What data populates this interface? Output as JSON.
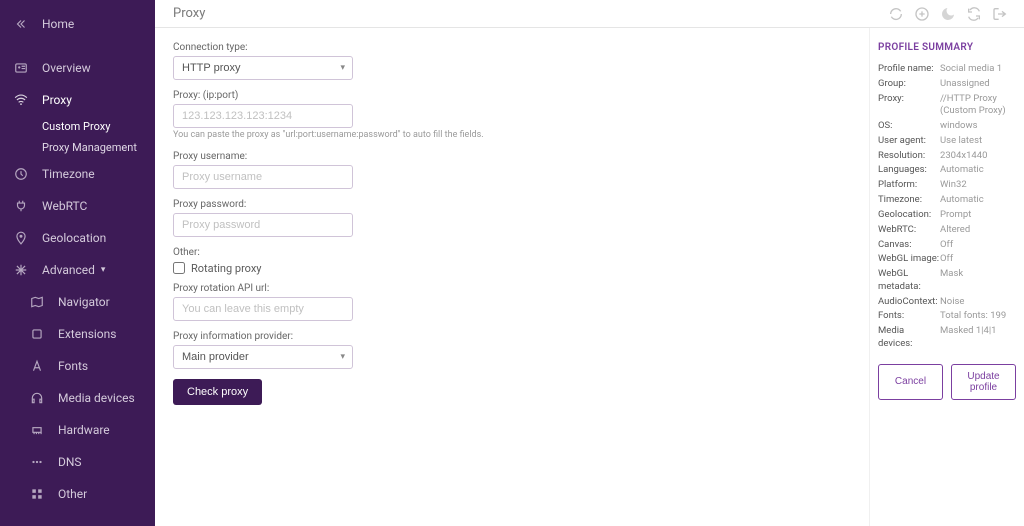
{
  "topbar": {
    "title": "Proxy"
  },
  "sidebar": {
    "home": "Home",
    "items": [
      {
        "label": "Overview"
      },
      {
        "label": "Proxy",
        "active": true,
        "subs": [
          {
            "label": "Custom Proxy",
            "active": true
          },
          {
            "label": "Proxy Management"
          }
        ]
      },
      {
        "label": "Timezone"
      },
      {
        "label": "WebRTC"
      },
      {
        "label": "Geolocation"
      },
      {
        "label": "Advanced",
        "subs": [
          {
            "label": "Navigator"
          },
          {
            "label": "Extensions"
          },
          {
            "label": "Fonts"
          },
          {
            "label": "Media devices"
          },
          {
            "label": "Hardware"
          },
          {
            "label": "DNS"
          },
          {
            "label": "Other"
          }
        ]
      }
    ]
  },
  "form": {
    "connection_type_label": "Connection type:",
    "connection_type_value": "HTTP proxy",
    "proxy_label": "Proxy: (ip:port)",
    "proxy_placeholder": "123.123.123.123:1234",
    "proxy_hint": "You can paste the proxy as \"url:port:username:password\" to auto fill the fields.",
    "username_label": "Proxy username:",
    "username_placeholder": "Proxy username",
    "password_label": "Proxy password:",
    "password_placeholder": "Proxy password",
    "other_label": "Other:",
    "rotating_label": "Rotating proxy",
    "rotation_url_label": "Proxy rotation API url:",
    "rotation_url_placeholder": "You can leave this empty",
    "provider_label": "Proxy information provider:",
    "provider_value": "Main provider",
    "check_button": "Check proxy"
  },
  "summary": {
    "title": "PROFILE SUMMARY",
    "rows": [
      {
        "k": "Profile name:",
        "v": "Social media 1"
      },
      {
        "k": "Group:",
        "v": "Unassigned"
      },
      {
        "k": "Proxy:",
        "v": "//HTTP Proxy (Custom Proxy)"
      },
      {
        "k": "OS:",
        "v": "windows"
      },
      {
        "k": "User agent:",
        "v": "Use latest"
      },
      {
        "k": "Resolution:",
        "v": "2304x1440"
      },
      {
        "k": "Languages:",
        "v": "Automatic"
      },
      {
        "k": "Platform:",
        "v": "Win32"
      },
      {
        "k": "Timezone:",
        "v": "Automatic"
      },
      {
        "k": "Geolocation:",
        "v": "Prompt"
      },
      {
        "k": "WebRTC:",
        "v": "Altered"
      },
      {
        "k": "Canvas:",
        "v": "Off"
      },
      {
        "k": "WebGL image:",
        "v": "Off"
      },
      {
        "k": "WebGL metadata:",
        "v": "Mask"
      },
      {
        "k": "AudioContext:",
        "v": "Noise"
      },
      {
        "k": "Fonts:",
        "v": "Total fonts: 199"
      },
      {
        "k": "Media devices:",
        "v": "Masked 1|4|1"
      }
    ],
    "cancel": "Cancel",
    "update": "Update profile"
  }
}
